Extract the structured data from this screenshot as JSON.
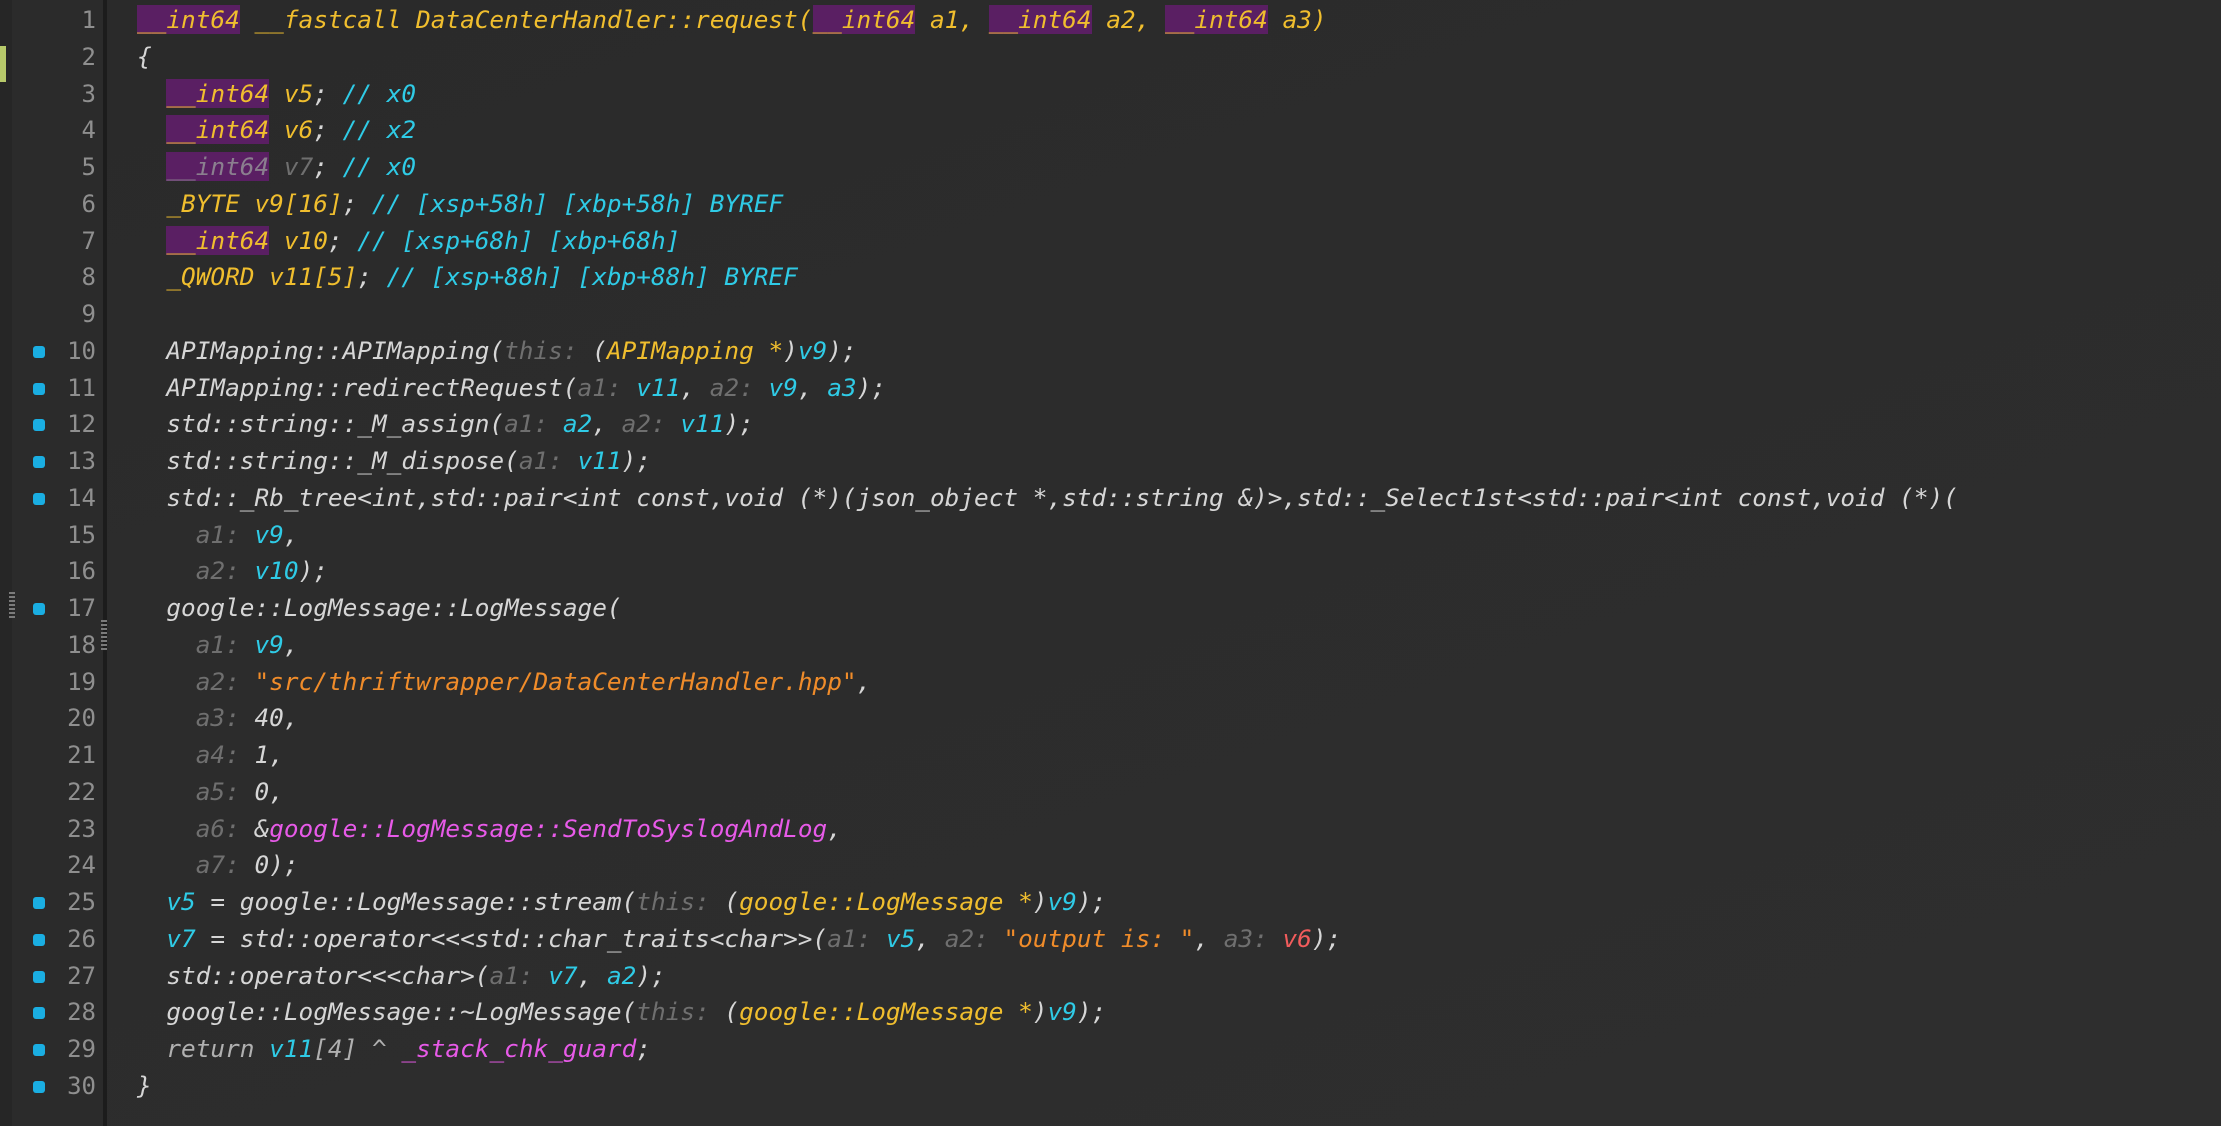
{
  "editor": {
    "colors": {
      "background": "#2c2c2c",
      "keyword": "#f0be2e",
      "keyword_highlight": "#5a1f63",
      "variable": "#2fcbe6",
      "string": "#f08c2a",
      "symbol": "#e75ae8",
      "hint": "#6f6f6f",
      "breakpoint": "#1aaee2",
      "line_number": "#8f8f8f"
    },
    "lines": [
      {
        "n": "1",
        "bp": false,
        "indent": "",
        "tokens": [
          {
            "t": "__int64",
            "c": "kwi"
          },
          {
            "t": " __fastcall DataCenterHandler::request(",
            "c": "kw"
          },
          {
            "t": "__int64",
            "c": "kwi"
          },
          {
            "t": " a1, ",
            "c": "kw"
          },
          {
            "t": "__int64",
            "c": "kwi"
          },
          {
            "t": " a2, ",
            "c": "kw"
          },
          {
            "t": "__int64",
            "c": "kwi"
          },
          {
            "t": " a3)",
            "c": "kw"
          }
        ]
      },
      {
        "n": "2",
        "bp": false,
        "indent": "",
        "tokens": [
          {
            "t": "{",
            "c": "plain"
          }
        ]
      },
      {
        "n": "3",
        "bp": false,
        "indent": "  ",
        "tokens": [
          {
            "t": "__int64",
            "c": "kwi"
          },
          {
            "t": " v5",
            "c": "kw"
          },
          {
            "t": "; ",
            "c": "plain"
          },
          {
            "t": "// x0",
            "c": "cm"
          }
        ]
      },
      {
        "n": "4",
        "bp": false,
        "indent": "  ",
        "tokens": [
          {
            "t": "__int64",
            "c": "kwi"
          },
          {
            "t": " v6",
            "c": "kw"
          },
          {
            "t": "; ",
            "c": "plain"
          },
          {
            "t": "// x2",
            "c": "cm"
          }
        ]
      },
      {
        "n": "5",
        "bp": false,
        "indent": "  ",
        "tokens": [
          {
            "t": "__int64",
            "c": "kwp"
          },
          {
            "t": " v7",
            "c": "hint"
          },
          {
            "t": "; ",
            "c": "plain"
          },
          {
            "t": "// x0",
            "c": "cm"
          }
        ]
      },
      {
        "n": "6",
        "bp": false,
        "indent": "  ",
        "tokens": [
          {
            "t": "_BYTE v9[16]",
            "c": "kw"
          },
          {
            "t": "; ",
            "c": "plain"
          },
          {
            "t": "// [xsp+58h] [xbp+58h] BYREF",
            "c": "cm"
          }
        ]
      },
      {
        "n": "7",
        "bp": false,
        "indent": "  ",
        "tokens": [
          {
            "t": "__int64",
            "c": "kwi"
          },
          {
            "t": " v10",
            "c": "kw"
          },
          {
            "t": "; ",
            "c": "plain"
          },
          {
            "t": "// [xsp+68h] [xbp+68h]",
            "c": "cm"
          }
        ]
      },
      {
        "n": "8",
        "bp": false,
        "indent": "  ",
        "tokens": [
          {
            "t": "_QWORD v11[5]",
            "c": "kw"
          },
          {
            "t": "; ",
            "c": "plain"
          },
          {
            "t": "// [xsp+88h] [xbp+88h] BYREF",
            "c": "cm"
          }
        ]
      },
      {
        "n": "9",
        "bp": false,
        "indent": "",
        "tokens": []
      },
      {
        "n": "10",
        "bp": true,
        "indent": "  ",
        "tokens": [
          {
            "t": "APIMapping::APIMapping(",
            "c": "plain"
          },
          {
            "t": "this: ",
            "c": "hint"
          },
          {
            "t": "(",
            "c": "plain"
          },
          {
            "t": "APIMapping *",
            "c": "kw"
          },
          {
            "t": ")",
            "c": "plain"
          },
          {
            "t": "v9",
            "c": "var"
          },
          {
            "t": ");",
            "c": "plain"
          }
        ]
      },
      {
        "n": "11",
        "bp": true,
        "indent": "  ",
        "tokens": [
          {
            "t": "APIMapping::redirectRequest(",
            "c": "plain"
          },
          {
            "t": "a1: ",
            "c": "hint"
          },
          {
            "t": "v11",
            "c": "var"
          },
          {
            "t": ", ",
            "c": "plain"
          },
          {
            "t": "a2: ",
            "c": "hint"
          },
          {
            "t": "v9",
            "c": "var"
          },
          {
            "t": ", ",
            "c": "plain"
          },
          {
            "t": "a3",
            "c": "var"
          },
          {
            "t": ");",
            "c": "plain"
          }
        ]
      },
      {
        "n": "12",
        "bp": true,
        "indent": "  ",
        "tokens": [
          {
            "t": "std::string::_M_assign(",
            "c": "plain"
          },
          {
            "t": "a1: ",
            "c": "hint"
          },
          {
            "t": "a2",
            "c": "var"
          },
          {
            "t": ", ",
            "c": "plain"
          },
          {
            "t": "a2: ",
            "c": "hint"
          },
          {
            "t": "v11",
            "c": "var"
          },
          {
            "t": ");",
            "c": "plain"
          }
        ]
      },
      {
        "n": "13",
        "bp": true,
        "indent": "  ",
        "tokens": [
          {
            "t": "std::string::_M_dispose(",
            "c": "plain"
          },
          {
            "t": "a1: ",
            "c": "hint"
          },
          {
            "t": "v11",
            "c": "var"
          },
          {
            "t": ");",
            "c": "plain"
          }
        ]
      },
      {
        "n": "14",
        "bp": true,
        "indent": "  ",
        "tokens": [
          {
            "t": "std::_Rb_tree<int,std::pair<int const,void (*)(json_object *,std::string &)>,std::_Select1st<std::pair<int const,void (*)(",
            "c": "plain"
          }
        ]
      },
      {
        "n": "15",
        "bp": false,
        "indent": "    ",
        "tokens": [
          {
            "t": "a1: ",
            "c": "hint"
          },
          {
            "t": "v9",
            "c": "var"
          },
          {
            "t": ",",
            "c": "plain"
          }
        ]
      },
      {
        "n": "16",
        "bp": false,
        "indent": "    ",
        "tokens": [
          {
            "t": "a2: ",
            "c": "hint"
          },
          {
            "t": "v10",
            "c": "var"
          },
          {
            "t": ");",
            "c": "plain"
          }
        ]
      },
      {
        "n": "17",
        "bp": true,
        "indent": "  ",
        "tokens": [
          {
            "t": "google::LogMessage::LogMessage(",
            "c": "plain"
          }
        ]
      },
      {
        "n": "18",
        "bp": false,
        "indent": "    ",
        "tokens": [
          {
            "t": "a1: ",
            "c": "hint"
          },
          {
            "t": "v9",
            "c": "var"
          },
          {
            "t": ",",
            "c": "plain"
          }
        ]
      },
      {
        "n": "19",
        "bp": false,
        "indent": "    ",
        "tokens": [
          {
            "t": "a2: ",
            "c": "hint"
          },
          {
            "t": "\"src/thriftwrapper/DataCenterHandler.hpp\"",
            "c": "str"
          },
          {
            "t": ",",
            "c": "plain"
          }
        ]
      },
      {
        "n": "20",
        "bp": false,
        "indent": "    ",
        "tokens": [
          {
            "t": "a3: ",
            "c": "hint"
          },
          {
            "t": "40",
            "c": "num"
          },
          {
            "t": ",",
            "c": "plain"
          }
        ]
      },
      {
        "n": "21",
        "bp": false,
        "indent": "    ",
        "tokens": [
          {
            "t": "a4: ",
            "c": "hint"
          },
          {
            "t": "1",
            "c": "num"
          },
          {
            "t": ",",
            "c": "plain"
          }
        ]
      },
      {
        "n": "22",
        "bp": false,
        "indent": "    ",
        "tokens": [
          {
            "t": "a5: ",
            "c": "hint"
          },
          {
            "t": "0",
            "c": "num"
          },
          {
            "t": ",",
            "c": "plain"
          }
        ]
      },
      {
        "n": "23",
        "bp": false,
        "indent": "    ",
        "tokens": [
          {
            "t": "a6: ",
            "c": "hint"
          },
          {
            "t": "&",
            "c": "plain"
          },
          {
            "t": "google::LogMessage::SendToSyslogAndLog",
            "c": "mag"
          },
          {
            "t": ",",
            "c": "plain"
          }
        ]
      },
      {
        "n": "24",
        "bp": false,
        "indent": "    ",
        "tokens": [
          {
            "t": "a7: ",
            "c": "hint"
          },
          {
            "t": "0",
            "c": "num"
          },
          {
            "t": ");",
            "c": "plain"
          }
        ]
      },
      {
        "n": "25",
        "bp": true,
        "indent": "  ",
        "tokens": [
          {
            "t": "v5",
            "c": "var"
          },
          {
            "t": " = google::LogMessage::stream(",
            "c": "plain"
          },
          {
            "t": "this: ",
            "c": "hint"
          },
          {
            "t": "(",
            "c": "plain"
          },
          {
            "t": "google::LogMessage *",
            "c": "kw"
          },
          {
            "t": ")",
            "c": "plain"
          },
          {
            "t": "v9",
            "c": "var"
          },
          {
            "t": ");",
            "c": "plain"
          }
        ]
      },
      {
        "n": "26",
        "bp": true,
        "indent": "  ",
        "tokens": [
          {
            "t": "v7",
            "c": "var"
          },
          {
            "t": " = std::operator<<<std::char_traits<char>>(",
            "c": "plain"
          },
          {
            "t": "a1: ",
            "c": "hint"
          },
          {
            "t": "v5",
            "c": "var"
          },
          {
            "t": ", ",
            "c": "plain"
          },
          {
            "t": "a2: ",
            "c": "hint"
          },
          {
            "t": "\"output is: \"",
            "c": "str"
          },
          {
            "t": ", ",
            "c": "plain"
          },
          {
            "t": "a3: ",
            "c": "hint"
          },
          {
            "t": "v6",
            "c": "red"
          },
          {
            "t": ");",
            "c": "plain"
          }
        ]
      },
      {
        "n": "27",
        "bp": true,
        "indent": "  ",
        "tokens": [
          {
            "t": "std::operator<<<char>(",
            "c": "plain"
          },
          {
            "t": "a1: ",
            "c": "hint"
          },
          {
            "t": "v7",
            "c": "var"
          },
          {
            "t": ", ",
            "c": "plain"
          },
          {
            "t": "a2",
            "c": "var"
          },
          {
            "t": ");",
            "c": "plain"
          }
        ]
      },
      {
        "n": "28",
        "bp": true,
        "indent": "  ",
        "tokens": [
          {
            "t": "google::LogMessage::~LogMessage(",
            "c": "plain"
          },
          {
            "t": "this: ",
            "c": "hint"
          },
          {
            "t": "(",
            "c": "plain"
          },
          {
            "t": "google::LogMessage *",
            "c": "kw"
          },
          {
            "t": ")",
            "c": "plain"
          },
          {
            "t": "v9",
            "c": "var"
          },
          {
            "t": ");",
            "c": "plain"
          }
        ]
      },
      {
        "n": "29",
        "bp": true,
        "indent": "  ",
        "tokens": [
          {
            "t": "return ",
            "c": "dim"
          },
          {
            "t": "v11",
            "c": "var"
          },
          {
            "t": "[4] ^ ",
            "c": "dim"
          },
          {
            "t": "_stack_chk_guard",
            "c": "mag"
          },
          {
            "t": ";",
            "c": "plain"
          }
        ]
      },
      {
        "n": "30",
        "bp": true,
        "indent": "",
        "tokens": [
          {
            "t": "}",
            "c": "plain"
          }
        ]
      }
    ]
  }
}
